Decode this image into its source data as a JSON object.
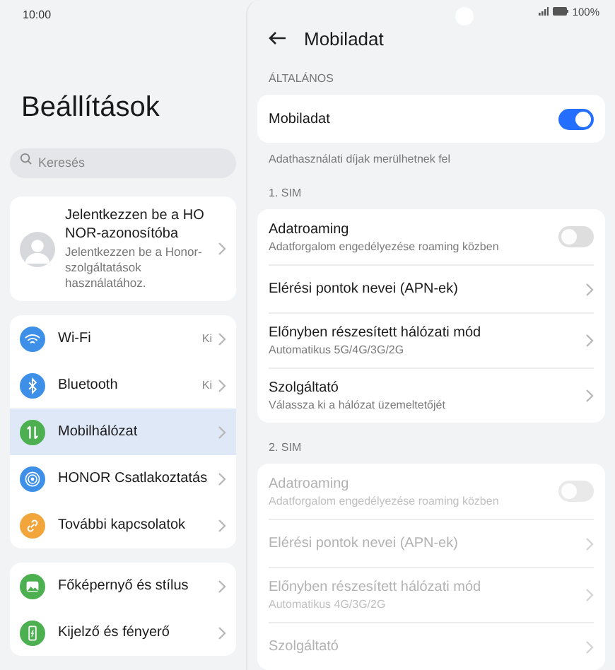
{
  "left_status": {
    "time": "10:00"
  },
  "settings": {
    "title": "Beállítások",
    "search": {
      "placeholder": "Keresés"
    },
    "account": {
      "title": "Jelentkezzen be a HONOR-azonosítóba",
      "subtitle": "Jelentkezzen be a Honor-szolgáltatások használatához."
    },
    "groups": [
      {
        "items": [
          {
            "label": "Wi-Fi",
            "value": "Ki",
            "color": "#3d8fe8",
            "selected": false
          },
          {
            "label": "Bluetooth",
            "value": "Ki",
            "color": "#3d8fe8",
            "selected": false
          },
          {
            "label": "Mobilhálózat",
            "color": "#4caf50",
            "selected": true
          },
          {
            "label": "HONOR Csatlakoztatás",
            "color": "#3d8fe8",
            "selected": false
          },
          {
            "label": "További kapcsolatok",
            "color": "#f2a53a",
            "selected": false
          }
        ]
      },
      {
        "items": [
          {
            "label": "Főképernyő és stílus",
            "color": "#4caf50",
            "selected": false
          },
          {
            "label": "Kijelző és fényerő",
            "color": "#4caf50",
            "selected": false
          }
        ]
      }
    ]
  },
  "right_status": {
    "battery": "100%"
  },
  "mobile_data": {
    "title": "Mobiladat",
    "sections": [
      {
        "header": "ÁLTALÁNOS",
        "note": "Adathasználati díjak merülhetnek fel",
        "items": [
          {
            "kind": "toggle",
            "title": "Mobiladat",
            "on": true,
            "disabled": false
          }
        ]
      },
      {
        "header": "1. SIM",
        "items": [
          {
            "kind": "toggle",
            "title": "Adatroaming",
            "subtitle": "Adatforgalom engedélyezése roaming közben",
            "on": false,
            "disabled": false
          },
          {
            "kind": "link",
            "title": "Elérési pontok nevei (APN-ek)",
            "disabled": false
          },
          {
            "kind": "link",
            "title": "Előnyben részesített hálózati mód",
            "subtitle": "Automatikus 5G/4G/3G/2G",
            "disabled": false
          },
          {
            "kind": "link",
            "title": "Szolgáltató",
            "subtitle": "Válassza ki a hálózat üzemeltetőjét",
            "disabled": false
          }
        ]
      },
      {
        "header": "2. SIM",
        "items": [
          {
            "kind": "toggle",
            "title": "Adatroaming",
            "subtitle": "Adatforgalom engedélyezése roaming közben",
            "on": false,
            "disabled": true
          },
          {
            "kind": "link",
            "title": "Elérési pontok nevei (APN-ek)",
            "disabled": true
          },
          {
            "kind": "link",
            "title": "Előnyben részesített hálózati mód",
            "subtitle": "Automatikus 4G/3G/2G",
            "disabled": true
          },
          {
            "kind": "link",
            "title": "Szolgáltató",
            "disabled": true
          }
        ]
      }
    ]
  }
}
